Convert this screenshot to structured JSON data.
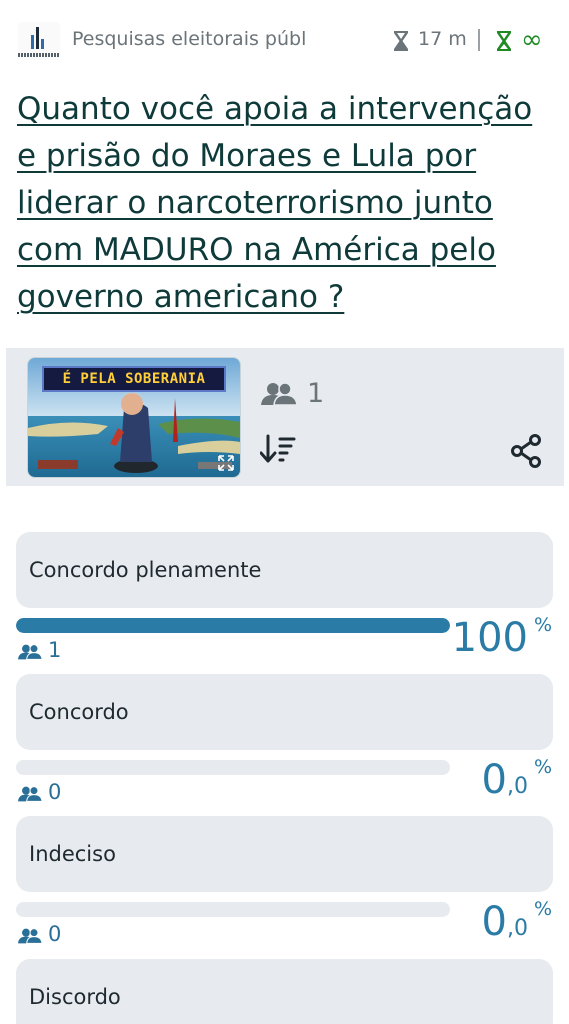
{
  "header": {
    "source_name": "Pesquisas eleitorais públ",
    "time_left": "17 m",
    "duration_symbol": "∞"
  },
  "poll": {
    "title": "Quanto você apoia a intervenção e prisão do Moraes e Lula por liderar o narcoterrorismo junto com MADURO na América pelo governo americano ?",
    "image_banner_text": "É PELA SOBERANIA",
    "total_voters": "1"
  },
  "options": [
    {
      "label": "Concordo plenamente",
      "voters": "1",
      "percent_int": "100",
      "percent_dec": "",
      "fill_fraction": 1.0
    },
    {
      "label": "Concordo",
      "voters": "0",
      "percent_int": "0",
      "percent_dec": ",0",
      "fill_fraction": 0.0
    },
    {
      "label": "Indeciso",
      "voters": "0",
      "percent_int": "0",
      "percent_dec": ",0",
      "fill_fraction": 0.0
    },
    {
      "label": "Discordo"
    }
  ],
  "percent_sign": "%",
  "colors": {
    "accent": "#2a7ba6",
    "card_bg": "#e7ebef",
    "title": "#0f3a3a",
    "unlimited_green": "#1f8a24"
  },
  "icons": [
    "poll-logo-icon",
    "hourglass-icon",
    "infinity-icon",
    "voters-icon",
    "sort-icon",
    "share-icon",
    "expand-icon"
  ]
}
